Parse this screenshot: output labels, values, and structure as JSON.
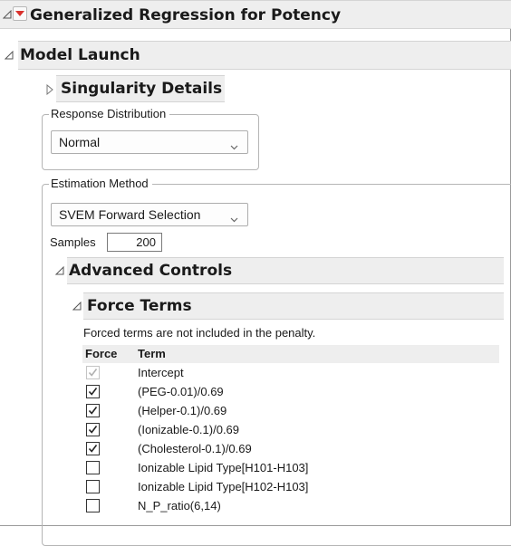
{
  "report": {
    "title": "Generalized Regression for Potency"
  },
  "model_launch": {
    "title": "Model Launch",
    "singularity_details": "Singularity Details",
    "response_distribution": {
      "legend": "Response Distribution",
      "value": "Normal"
    },
    "estimation_method": {
      "legend": "Estimation Method",
      "value": "SVEM Forward Selection",
      "samples_label": "Samples",
      "samples_value": "200"
    },
    "advanced_controls": {
      "title": "Advanced Controls",
      "force_terms": {
        "title": "Force Terms",
        "note": "Forced terms are not included in the penalty.",
        "columns": {
          "force": "Force",
          "term": "Term"
        },
        "rows": [
          {
            "term": "Intercept",
            "checked": true,
            "enabled": false
          },
          {
            "term": "(PEG-0.01)/0.69",
            "checked": true,
            "enabled": true
          },
          {
            "term": "(Helper-0.1)/0.69",
            "checked": true,
            "enabled": true
          },
          {
            "term": "(Ionizable-0.1)/0.69",
            "checked": true,
            "enabled": true
          },
          {
            "term": "(Cholesterol-0.1)/0.69",
            "checked": true,
            "enabled": true
          },
          {
            "term": "Ionizable Lipid Type[H101-H103]",
            "checked": false,
            "enabled": true
          },
          {
            "term": "Ionizable Lipid Type[H102-H103]",
            "checked": false,
            "enabled": true
          },
          {
            "term": "N_P_ratio(6,14)",
            "checked": false,
            "enabled": true
          }
        ]
      }
    }
  },
  "colors": {
    "header_bg": "#eeeeee",
    "red_menu": "#d9312c",
    "disabled_check": "#b0b0b0"
  }
}
